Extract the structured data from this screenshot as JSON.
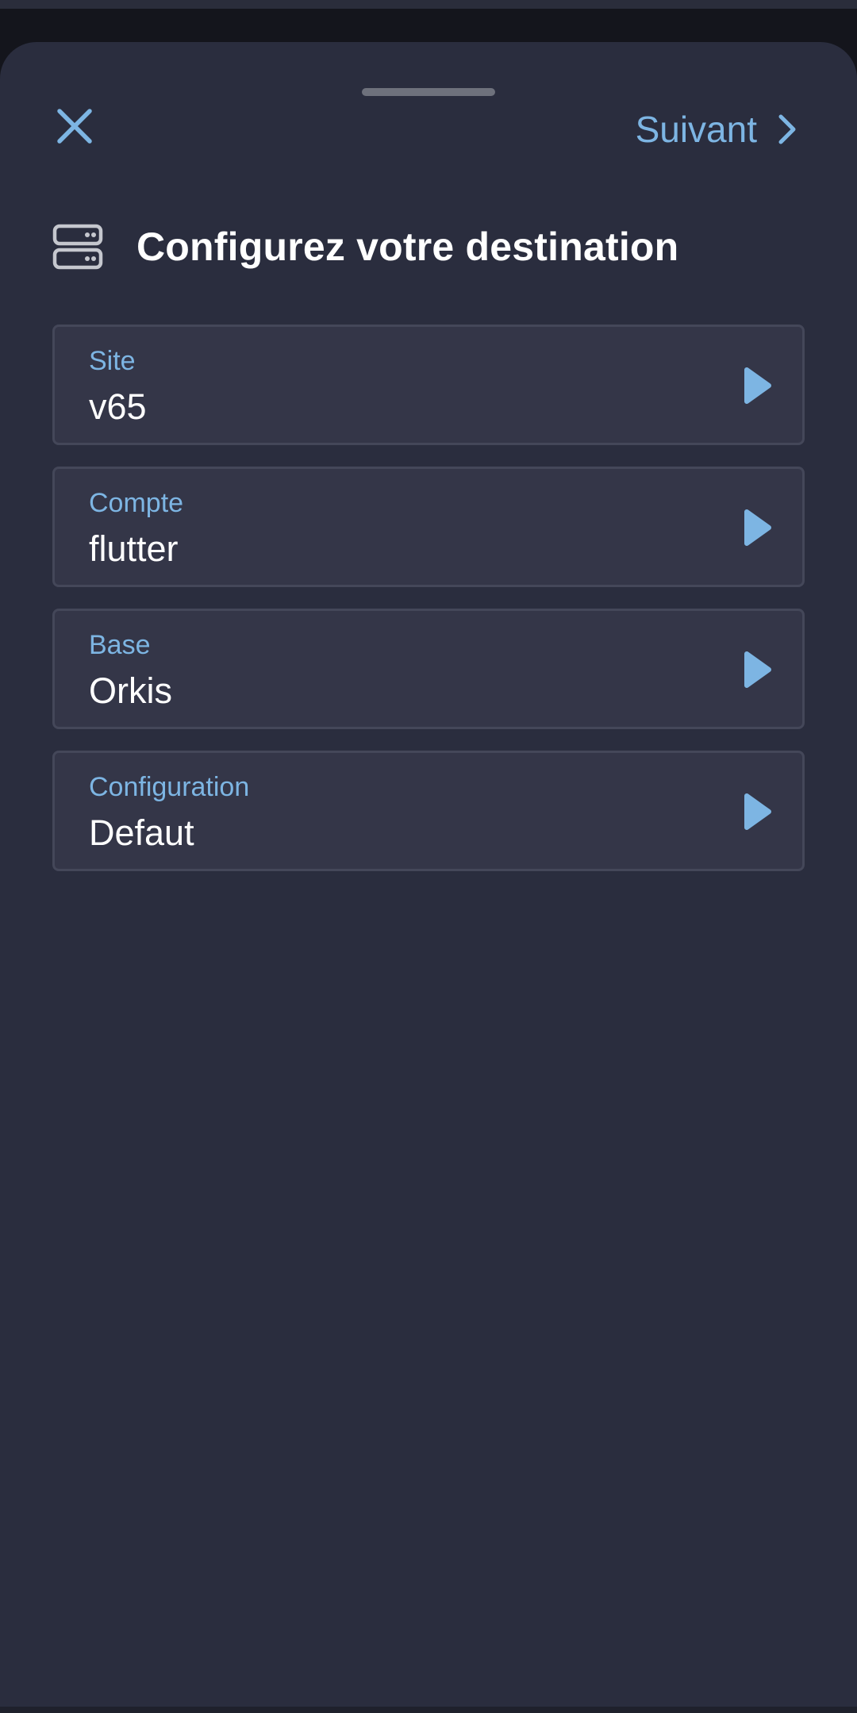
{
  "header": {
    "next_label": "Suivant",
    "title": "Configurez votre destination"
  },
  "fields": [
    {
      "label": "Site",
      "value": "v65"
    },
    {
      "label": "Compte",
      "value": "flutter"
    },
    {
      "label": "Base",
      "value": "Orkis"
    },
    {
      "label": "Configuration",
      "value": "Defaut"
    }
  ],
  "icons": {
    "close": "close-icon",
    "next": "chevron-right-icon",
    "header": "server-icon",
    "field_arrow": "play-arrow-icon"
  },
  "colors": {
    "accent": "#7db5e3",
    "sheet_background": "#2a2d3e",
    "field_background": "#343648",
    "text": "#ffffff"
  }
}
